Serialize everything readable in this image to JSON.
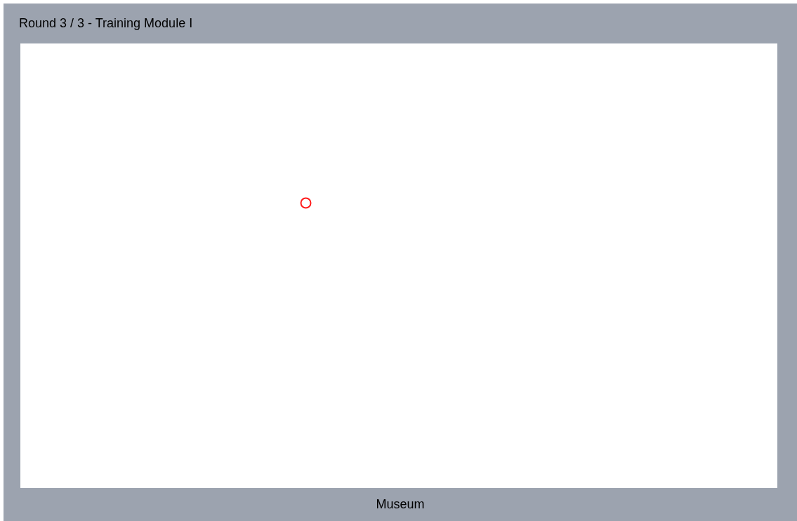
{
  "header": {
    "title": "Round 3 / 3 - Training Module I"
  },
  "canvas": {
    "marker": true
  },
  "footer": {
    "label": "Museum"
  }
}
